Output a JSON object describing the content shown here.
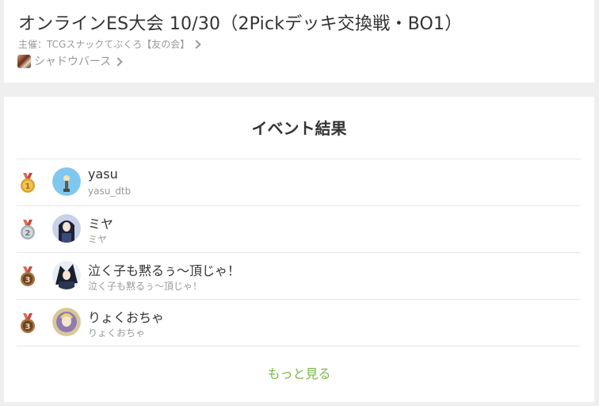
{
  "event": {
    "title": "オンラインES大会 10/30（2Pickデッキ交換戦・BO1）",
    "organizer": "主催：TCGスナックてぶくろ【友の会】",
    "game": "シャドウバース"
  },
  "results": {
    "title": "イベント結果",
    "rows": [
      {
        "rank": "1",
        "name": "yasu",
        "handle": "yasu_dtb",
        "medal_color": "#d9a233",
        "avatar": "avatar-1"
      },
      {
        "rank": "2",
        "name": "ミヤ",
        "handle": "ミヤ",
        "medal_color": "#a8b0b8",
        "avatar": "avatar-2"
      },
      {
        "rank": "3",
        "name": "泣く子も黙るぅ～頂じゃ！",
        "handle": "泣く子も黙るぅ～頂じゃ！",
        "medal_color": "#a9713c",
        "avatar": "avatar-3"
      },
      {
        "rank": "3",
        "name": "りょくおちゃ",
        "handle": "りょくおちゃ",
        "medal_color": "#a9713c",
        "avatar": "avatar-4"
      }
    ],
    "more_label": "もっと見る"
  },
  "colors": {
    "accent": "#7ab648",
    "gold": "#d9a233",
    "silver": "#a8b0b8",
    "bronze": "#a9713c"
  }
}
